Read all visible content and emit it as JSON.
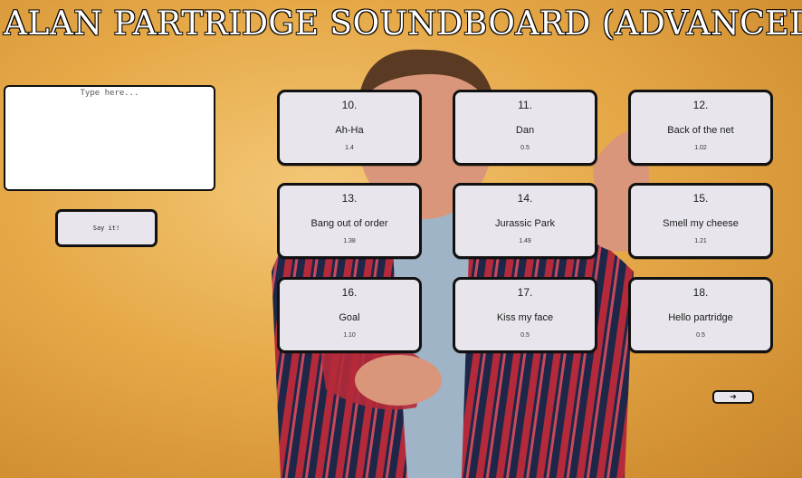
{
  "app": {
    "title": "ALAN PARTRIDGE SOUNDBOARD (ADVANCED)"
  },
  "input": {
    "placeholder": "Type here...",
    "value": ""
  },
  "say_button": {
    "label": "Say it!"
  },
  "sounds": [
    {
      "number": "10.",
      "name": "Ah-Ha",
      "duration": "1.4"
    },
    {
      "number": "11.",
      "name": "Dan",
      "duration": "0.5"
    },
    {
      "number": "12.",
      "name": "Back of the net",
      "duration": "1.02"
    },
    {
      "number": "13.",
      "name": "Bang out of order",
      "duration": "1.38"
    },
    {
      "number": "14.",
      "name": "Jurassic Park",
      "duration": "1.49"
    },
    {
      "number": "15.",
      "name": "Smell my cheese",
      "duration": "1.21"
    },
    {
      "number": "16.",
      "name": "Goal",
      "duration": "1.10"
    },
    {
      "number": "17.",
      "name": "Kiss my face",
      "duration": "0.5"
    },
    {
      "number": "18.",
      "name": "Hello partridge",
      "duration": "0.5"
    }
  ],
  "next_button": {
    "label": "➔"
  },
  "background": {
    "description_colors": {
      "backdrop": "#e6a948",
      "jacket_stripe_red": "#b42a3a",
      "jacket_stripe_navy": "#1e2748",
      "shirt": "#9fb4c6",
      "skin": "#d9967a",
      "hair": "#5a3a22"
    }
  }
}
